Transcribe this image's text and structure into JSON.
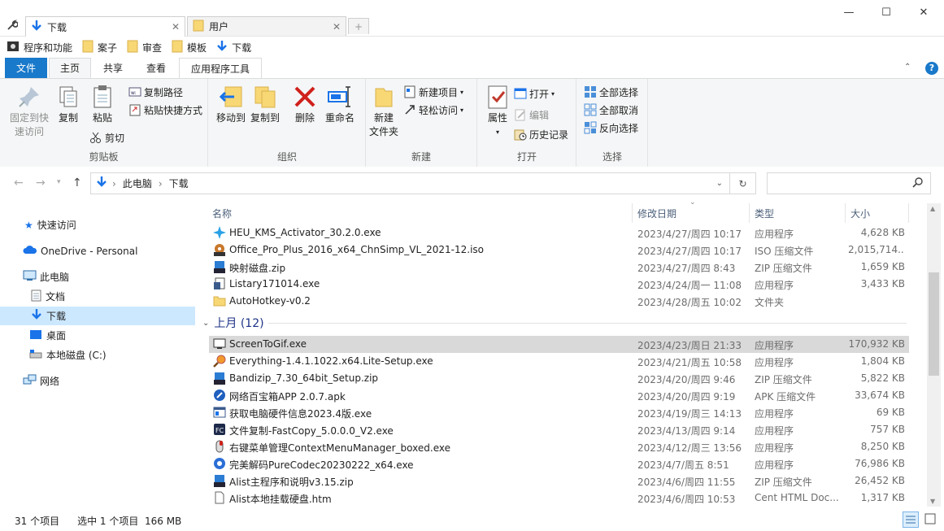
{
  "tabs": [
    {
      "label": "下载",
      "active": true
    },
    {
      "label": "用户",
      "active": false
    }
  ],
  "window_controls": {
    "minimize": "—",
    "maximize": "☐",
    "close": "✕"
  },
  "favorites": [
    {
      "label": "程序和功能",
      "icon": "control-panel-icon"
    },
    {
      "label": "案子",
      "icon": "folder-icon"
    },
    {
      "label": "审查",
      "icon": "folder-icon"
    },
    {
      "label": "模板",
      "icon": "folder-icon"
    },
    {
      "label": "下载",
      "icon": "download-arrow-icon"
    }
  ],
  "ribbon_tabs": [
    "文件",
    "主页",
    "共享",
    "查看",
    "应用程序工具"
  ],
  "ribbon": {
    "clipboard": {
      "pin": "固定到快\n速访问",
      "copy": "复制",
      "paste": "粘贴",
      "copy_path": "复制路径",
      "paste_shortcut": "粘贴快捷方式",
      "cut": "剪切",
      "label": "剪贴板"
    },
    "organize": {
      "move_to": "移动到",
      "copy_to": "复制到",
      "delete": "删除",
      "rename": "重命名",
      "label": "组织"
    },
    "new": {
      "new_folder": "新建\n文件夹",
      "new_item": "新建项目",
      "easy_access": "轻松访问",
      "label": "新建"
    },
    "open": {
      "properties": "属性",
      "open": "打开",
      "edit": "编辑",
      "history": "历史记录",
      "label": "打开"
    },
    "select": {
      "select_all": "全部选择",
      "select_none": "全部取消",
      "invert": "反向选择",
      "label": "选择"
    }
  },
  "address": {
    "segments": [
      "此电脑",
      "下载"
    ]
  },
  "nav_pane": [
    {
      "label": "快速访问",
      "icon": "star-icon"
    },
    {
      "label": "OneDrive - Personal",
      "icon": "cloud-icon"
    },
    {
      "label": "此电脑",
      "icon": "computer-icon"
    },
    {
      "label": "文档",
      "icon": "document-icon"
    },
    {
      "label": "下载",
      "icon": "download-arrow-icon"
    },
    {
      "label": "桌面",
      "icon": "desktop-icon"
    },
    {
      "label": "本地磁盘 (C:)",
      "icon": "drive-icon"
    },
    {
      "label": "网络",
      "icon": "network-icon"
    }
  ],
  "columns": {
    "name": "名称",
    "date": "修改日期",
    "type": "类型",
    "size": "大小"
  },
  "files_top": [
    {
      "name": "HEU_KMS_Activator_30.2.0.exe",
      "date": "2023/4/27/周四 10:17",
      "type": "应用程序",
      "size": "4,628 KB",
      "icon": "kms-icon"
    },
    {
      "name": "Office_Pro_Plus_2016_x64_ChnSimp_VL_2021-12.iso",
      "date": "2023/4/27/周四 10:17",
      "type": "ISO 压缩文件",
      "size": "2,015,714...",
      "icon": "iso-icon"
    },
    {
      "name": "映射磁盘.zip",
      "date": "2023/4/27/周四 8:43",
      "type": "ZIP 压缩文件",
      "size": "1,659 KB",
      "icon": "zip-icon"
    },
    {
      "name": "Listary171014.exe",
      "date": "2023/4/24/周一 11:08",
      "type": "应用程序",
      "size": "3,433 KB",
      "icon": "installer-icon"
    },
    {
      "name": "AutoHotkey-v0.2",
      "date": "2023/4/28/周五 10:02",
      "type": "文件夹",
      "size": "",
      "icon": "folder-icon"
    }
  ],
  "group_label": "上月 (12)",
  "files_last_month": [
    {
      "name": "ScreenToGif.exe",
      "date": "2023/4/23/周日 21:33",
      "type": "应用程序",
      "size": "170,932 KB",
      "icon": "screentogif-icon",
      "selected": true
    },
    {
      "name": "Everything-1.4.1.1022.x64.Lite-Setup.exe",
      "date": "2023/4/21/周五 10:58",
      "type": "应用程序",
      "size": "1,804 KB",
      "icon": "magnifier-icon"
    },
    {
      "name": "Bandizip_7.30_64bit_Setup.zip",
      "date": "2023/4/20/周四 9:46",
      "type": "ZIP 压缩文件",
      "size": "5,822 KB",
      "icon": "zip-icon"
    },
    {
      "name": "网络百宝箱APP 2.0.7.apk",
      "date": "2023/4/20/周四 9:19",
      "type": "APK 压缩文件",
      "size": "33,674 KB",
      "icon": "apk-icon"
    },
    {
      "name": "获取电脑硬件信息2023.4版.exe",
      "date": "2023/4/19/周三 14:13",
      "type": "应用程序",
      "size": "69 KB",
      "icon": "app-window-icon"
    },
    {
      "name": "文件复制-FastCopy_5.0.0.0_V2.exe",
      "date": "2023/4/13/周四 9:14",
      "type": "应用程序",
      "size": "757 KB",
      "icon": "fastcopy-icon"
    },
    {
      "name": "右键菜单管理ContextMenuManager_boxed.exe",
      "date": "2023/4/12/周三 13:56",
      "type": "应用程序",
      "size": "8,250 KB",
      "icon": "mouse-icon"
    },
    {
      "name": "完美解码PureCodec20230222_x64.exe",
      "date": "2023/4/7/周五 8:51",
      "type": "应用程序",
      "size": "76,986 KB",
      "icon": "codec-icon"
    },
    {
      "name": "Alist主程序和说明v3.15.zip",
      "date": "2023/4/6/周四 11:55",
      "type": "ZIP 压缩文件",
      "size": "26,452 KB",
      "icon": "zip-icon"
    },
    {
      "name": "Alist本地挂载硬盘.htm",
      "date": "2023/4/6/周四 10:53",
      "type": "Cent HTML Doc...",
      "size": "1,317 KB",
      "icon": "html-file-icon"
    }
  ],
  "status": {
    "count": "31 个项目",
    "selection": "选中 1 个项目  166 MB"
  },
  "colors": {
    "accent": "#1979ca",
    "selection": "#cce8ff",
    "row_selected": "#d9d9d9",
    "folder": "#f8d775"
  }
}
